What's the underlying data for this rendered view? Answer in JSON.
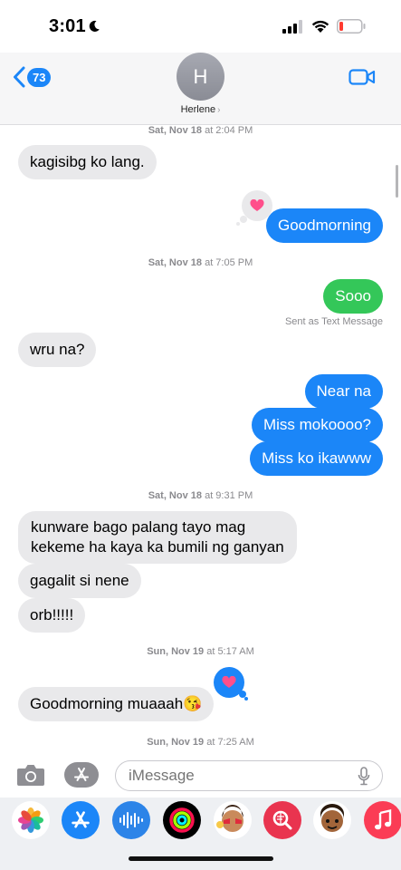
{
  "status_bar": {
    "time": "3:01",
    "icons": [
      "moon-icon",
      "signal-icon",
      "wifi-icon",
      "battery-low-icon"
    ],
    "battery_color": "#ff3b30"
  },
  "header": {
    "back_badge_count": "73",
    "avatar_initial": "H",
    "contact_name": "Herlene",
    "name_chevron": "›",
    "icons": [
      "back-chevron-icon",
      "video-call-icon"
    ],
    "accent_color": "#1b86f8"
  },
  "thread": {
    "timestamps": [
      {
        "day": "Sat, Nov 18",
        "rest": " at 2:04 PM"
      },
      {
        "day": "Sat, Nov 18",
        "rest": " at 7:05 PM"
      },
      {
        "day": "Sat, Nov 18",
        "rest": " at 9:31 PM"
      },
      {
        "day": "Sun, Nov 19",
        "rest": " at 5:17 AM"
      },
      {
        "day": "Sun, Nov 19",
        "rest": " at 7:25 AM"
      }
    ],
    "messages": [
      {
        "direction": "incoming",
        "text": "kagisibg ko lang."
      },
      {
        "direction": "outgoing",
        "text": "Goodmorning",
        "reaction": "heart"
      },
      {
        "direction": "outgoing-sms",
        "text": "Sooo"
      },
      {
        "direction": "incoming",
        "text": "wru na?"
      },
      {
        "direction": "outgoing",
        "text": "Near na"
      },
      {
        "direction": "outgoing",
        "text": "Miss mokoooo?"
      },
      {
        "direction": "outgoing",
        "text": "Miss ko ikawww"
      },
      {
        "direction": "incoming",
        "text": "kunware bago palang tayo mag\nkekeme ha kaya ka bumili ng ganyan"
      },
      {
        "direction": "incoming",
        "text": "gagalit si nene"
      },
      {
        "direction": "incoming",
        "text": "orb!!!!!"
      },
      {
        "direction": "incoming",
        "text": "Goodmorning muaaah😘",
        "reaction": "heart"
      }
    ],
    "delivery_note": "Sent as Text Message",
    "colors": {
      "outgoing": "#1b86f8",
      "sms": "#34c759",
      "incoming": "#e9e9eb",
      "heart": "#ff4f8b"
    }
  },
  "input_bar": {
    "placeholder": "iMessage",
    "icons": [
      "camera-icon",
      "app-store-icon",
      "microphone-icon"
    ]
  },
  "app_drawer": {
    "apps": [
      "photos-icon",
      "app-store-icon",
      "audio-message-icon",
      "activity-icon",
      "memoji-stickers-icon",
      "web-search-icon",
      "memoji-icon",
      "music-icon"
    ]
  }
}
